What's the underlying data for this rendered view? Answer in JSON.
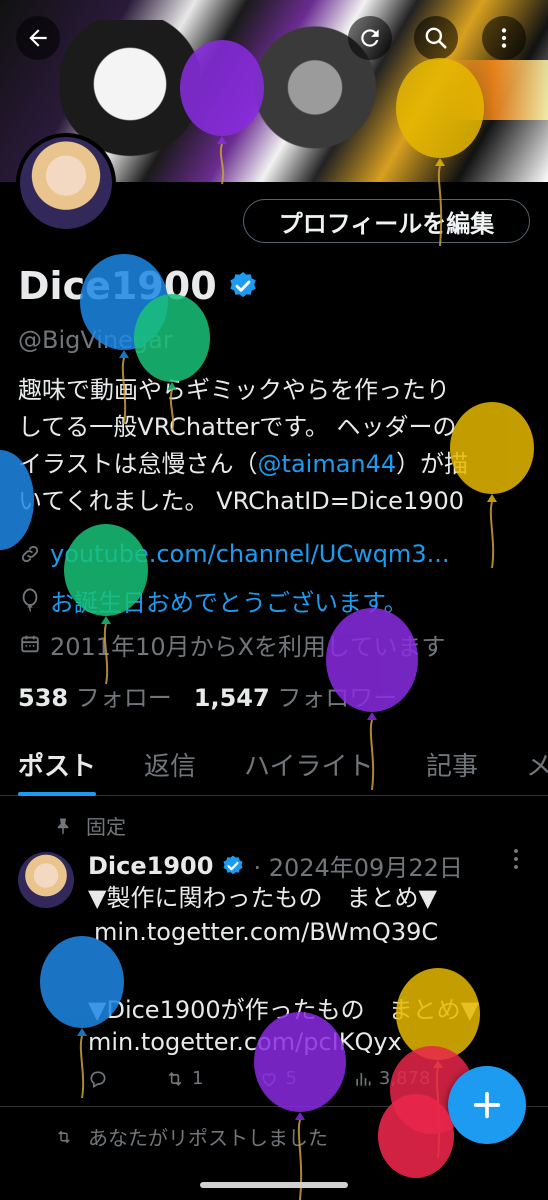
{
  "top_bar": {
    "back_icon": "arrow-left-icon",
    "refresh_icon": "refresh-icon",
    "search_icon": "search-icon",
    "more_icon": "more-vertical-icon"
  },
  "profile": {
    "edit_button": "プロフィールを編集",
    "display_name": "Dice1900",
    "handle": "@BigVinegar",
    "bio_1": "趣味で動画やらギミックやらを作ったり",
    "bio_2": "してる一般VRChatterです。 ヘッダーの",
    "bio_3a": "イラストは怠慢さん（",
    "bio_3_mention": "@taiman44",
    "bio_3b": "）が描",
    "bio_4": "いてくれました。 VRChatID=Dice1900",
    "website": "youtube.com/channel/UCwqm3...",
    "location": "お誕生日おめでとうございます。",
    "joined": "2011年10月からXを利用しています",
    "following_count": "538",
    "following_label": "フォロー",
    "followers_count": "1,547",
    "followers_label": "フォロワー"
  },
  "tabs": [
    "ポスト",
    "返信",
    "ハイライト",
    "記事",
    "メ"
  ],
  "pinned_label": "固定",
  "tweet": {
    "name": "Dice1900",
    "date": "· 2024年09月22日",
    "line_1": "▼製作に関わったもの　まとめ▼",
    "link_1": "min.togetter.com/BWmQ39C",
    "line_2": "▼Dice1900が作ったもの　まとめ▼",
    "link_2": "min.togetter.com/pcIKQyx",
    "retweets": "1",
    "likes": "5",
    "views": "3,878"
  },
  "repost_note": "あなたがリポストしました",
  "fab_icon": "plus-icon",
  "colors": {
    "accent": "#1d9bf0",
    "background": "#000000",
    "muted": "#71767b",
    "balloon_purple": "#8a2be2",
    "balloon_yellow": "#e6b800",
    "balloon_blue": "#1e88e5",
    "balloon_green": "#18c27a",
    "balloon_red": "#e8264a"
  }
}
